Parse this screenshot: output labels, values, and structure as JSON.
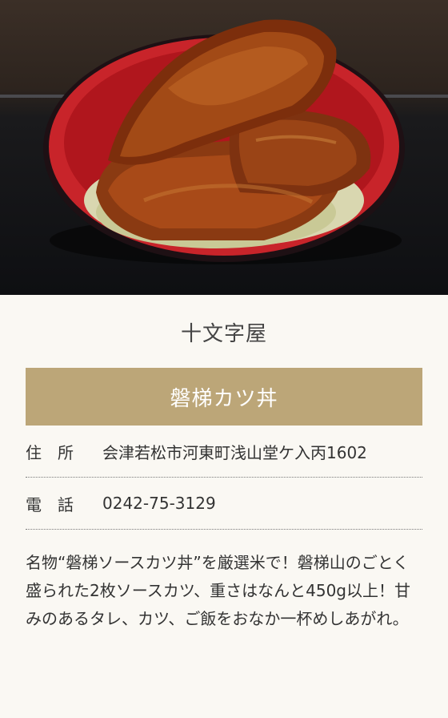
{
  "photo": {
    "alt": "磐梯カツ丼"
  },
  "shop": {
    "name": "十文字屋"
  },
  "dish": {
    "name": "磐梯カツ丼"
  },
  "info": {
    "address": {
      "label": "住　所",
      "value": "会津若松市河東町浅山堂ケ入丙1602"
    },
    "phone": {
      "label": "電　話",
      "value": "0242-75-3129"
    }
  },
  "description": "名物“磐梯ソースカツ丼”を厳選米で！磐梯山のごとく盛られた2枚ソースカツ、重さはなんと450g以上！甘みのあるタレ、カツ、ご飯をおなか一杯めしあがれ。"
}
